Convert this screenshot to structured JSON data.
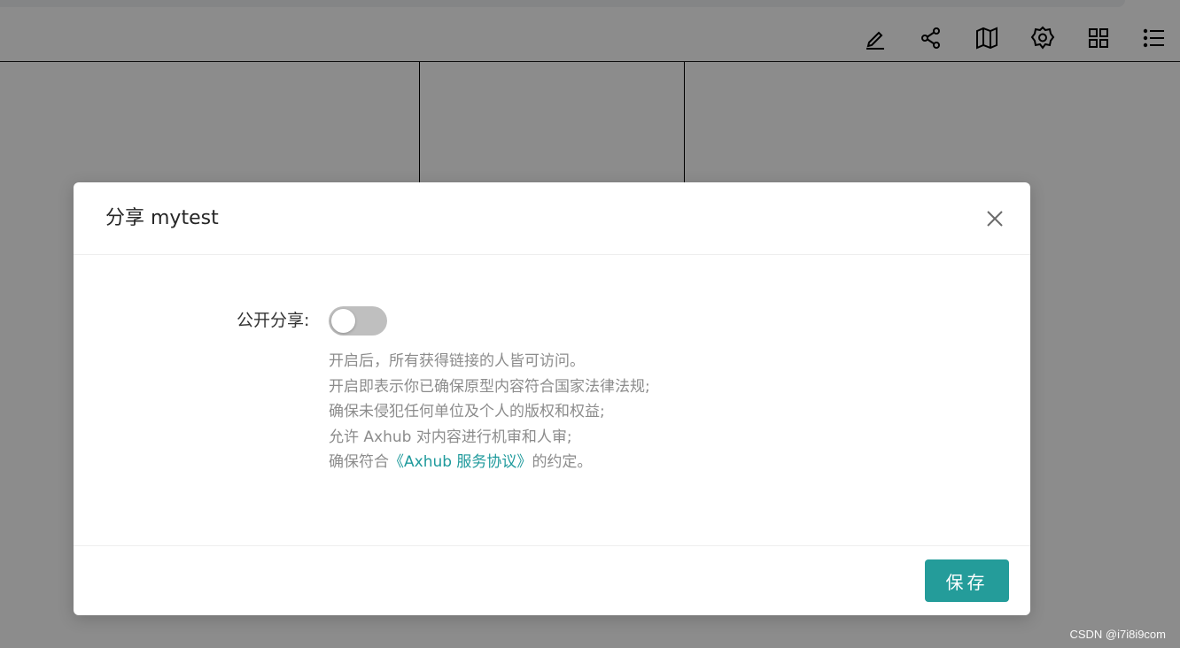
{
  "toolbar": {
    "icons": [
      "edit-icon",
      "share-icon",
      "map-icon",
      "settings-icon",
      "grid-icon",
      "list-icon"
    ]
  },
  "modal": {
    "title": "分享 mytest",
    "field_label": "公开分享:",
    "toggle_on": false,
    "description": {
      "line1": "开启后，所有获得链接的人皆可访问。",
      "line2": "开启即表示你已确保原型内容符合国家法律法规;",
      "line3": "确保未侵犯任何单位及个人的版权和权益;",
      "line4": "允许 Axhub 对内容进行机审和人审;",
      "line5_prefix": "确保符合",
      "line5_link": "《Axhub 服务协议》",
      "line5_suffix": "的约定。"
    },
    "save_label": "保存"
  },
  "watermark": "CSDN @i7i8i9com",
  "colors": {
    "accent": "#249c9a",
    "link": "#1f9a9c",
    "overlay": "rgba(0,0,0,0.45)"
  }
}
